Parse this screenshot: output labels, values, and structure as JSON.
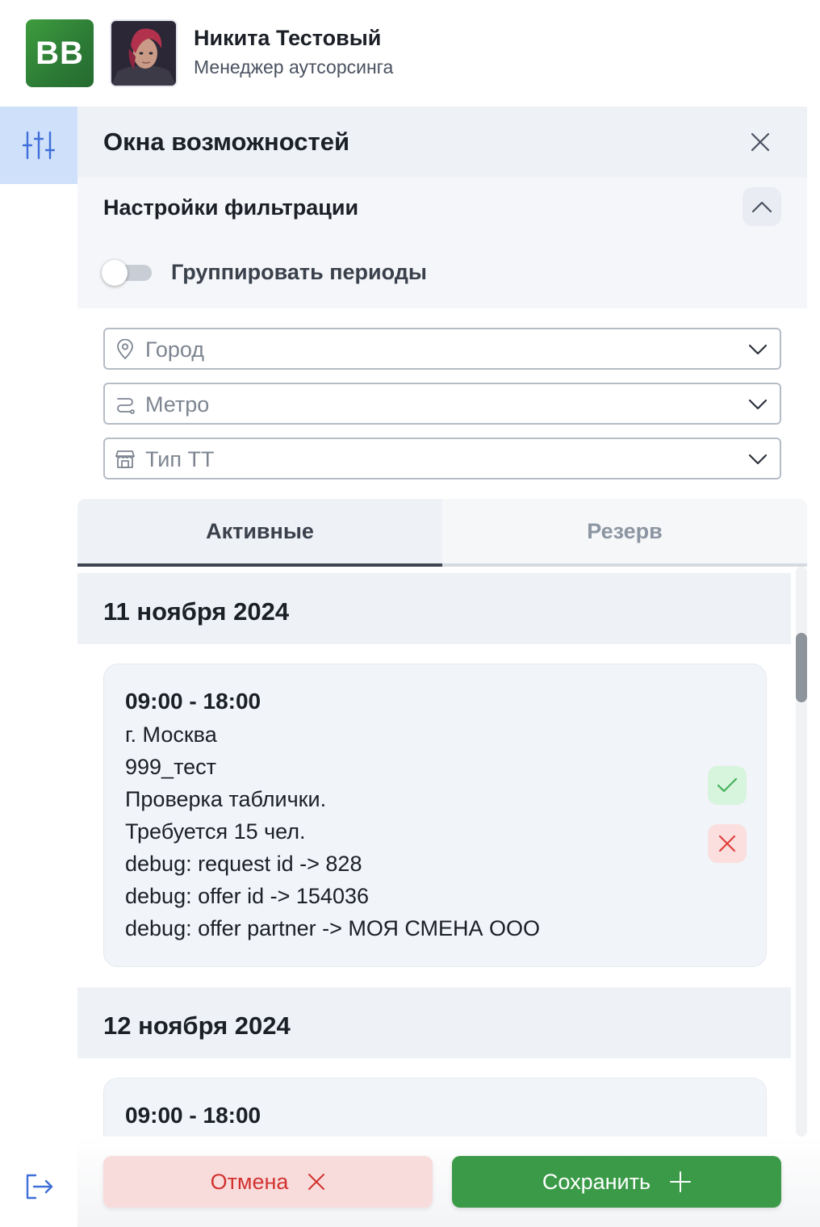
{
  "header": {
    "logo_text": "BB",
    "user_name": "Никита Тестовый",
    "user_role": "Менеджер аутсорсинга"
  },
  "panel": {
    "title": "Окна возможностей"
  },
  "filters": {
    "section_title": "Настройки фильтрации",
    "group_periods_label": "Группировать периоды",
    "group_periods_on": false,
    "city": {
      "placeholder": "Город",
      "icon": "map-pin-icon"
    },
    "metro": {
      "placeholder": "Метро",
      "icon": "route-icon"
    },
    "store_type": {
      "placeholder": "Тип ТТ",
      "icon": "store-icon"
    }
  },
  "tabs": [
    {
      "label": "Активные",
      "active": true
    },
    {
      "label": "Резерв",
      "active": false
    }
  ],
  "groups": [
    {
      "date": "11 ноября 2024",
      "offers": [
        {
          "time": "09:00 - 18:00",
          "lines": [
            "г. Москва",
            "999_тест",
            "Проверка таблички.",
            "Требуется 15 чел.",
            "debug: request id -> 828",
            "debug: offer id -> 154036",
            "debug: offer partner -> МОЯ СМЕНА ООО"
          ]
        }
      ]
    },
    {
      "date": "12 ноября 2024",
      "offers": [
        {
          "time": "09:00 - 18:00"
        }
      ]
    }
  ],
  "footer": {
    "cancel_label": "Отмена",
    "save_label": "Сохранить"
  },
  "colors": {
    "brand_green": "#3b9a47",
    "cancel_red": "#d2322f",
    "sidebar_active": "#cfe0fb",
    "accent_blue": "#3f6fd8"
  }
}
